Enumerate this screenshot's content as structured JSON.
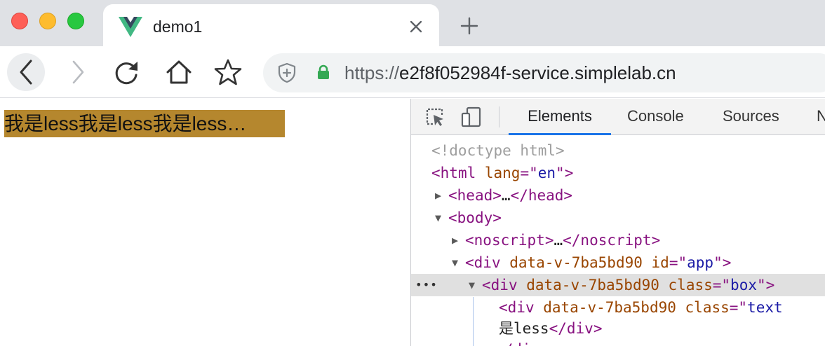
{
  "browser": {
    "tab": {
      "title": "demo1",
      "favicon": "vue-logo-icon"
    },
    "new_tab_icon": "plus-icon",
    "toolbar_icons": [
      "back-arrow-icon",
      "forward-arrow-icon",
      "reload-icon",
      "home-icon",
      "star-icon"
    ],
    "address": {
      "scheme": "https://",
      "host": "e2f8f052984f-service.simplelab.cn",
      "shield_icon": "shield-icon",
      "lock_icon": "lock-icon"
    },
    "colors": {
      "accent": "#1a73e8",
      "lock": "#34a853",
      "close": "#fe5f57",
      "minimize": "#febc2e",
      "maximize": "#28c840"
    }
  },
  "page": {
    "box_text": "我是less我是less我是less…",
    "box_color": "#b5872e"
  },
  "devtools": {
    "tabs": [
      "Elements",
      "Console",
      "Sources",
      "N"
    ],
    "active_tab": "Elements",
    "dom_lines": [
      {
        "doctype": "<!doctype html>"
      },
      {
        "open": "<",
        "tag": "html",
        "attr": " lang",
        "eq": "=\"",
        "val": "en",
        "close": "\">"
      },
      {
        "arrow": "▶",
        "open": "<",
        "tag": "head",
        "mid": ">",
        "ellipsis": "…",
        "end_open": "</",
        "end_tag": "head",
        "close": ">"
      },
      {
        "arrow": "▼",
        "open": "<",
        "tag": "body",
        "close": ">"
      },
      {
        "arrow": "▶",
        "open": "<",
        "tag": "noscript",
        "mid": ">",
        "ellipsis": "…",
        "end_open": "</",
        "end_tag": "noscript",
        "close": ">"
      },
      {
        "arrow": "▼",
        "open": "<",
        "tag": "div",
        "attr1": " data-v-7ba5bd90",
        "attr2": " id",
        "eq": "=\"",
        "val": "app",
        "close": "\">"
      },
      {
        "dots": "•••",
        "arrow": "▼",
        "open": "<",
        "tag": "div",
        "attr1": " data-v-7ba5bd90",
        "attr2": " class",
        "eq": "=\"",
        "val": "box",
        "close": "\">"
      },
      {
        "open": "<",
        "tag": "div",
        "attr1": " data-v-7ba5bd90",
        "attr2": " class",
        "eq": "=\"",
        "val": "text"
      },
      {
        "text": "是less",
        "end_open": "</",
        "end_tag": "div",
        "close": ">"
      },
      {
        "end_open": "</",
        "end_tag": "div"
      }
    ]
  }
}
